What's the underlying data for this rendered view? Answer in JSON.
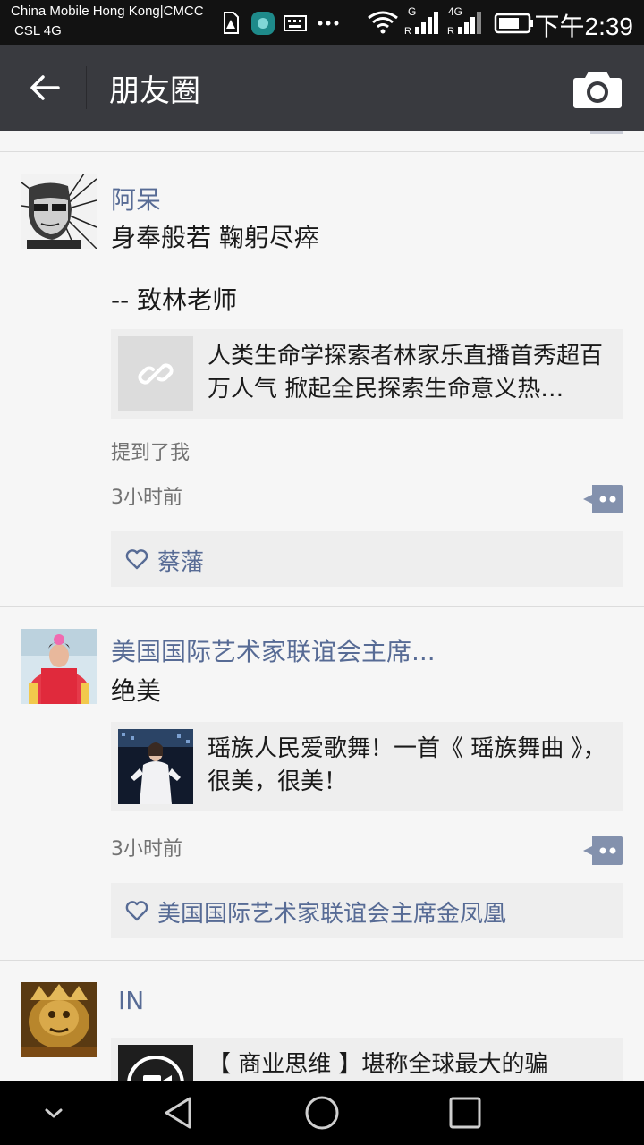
{
  "status_bar": {
    "carrier_line1": "China Mobile Hong Kong|CMCC",
    "carrier_line2": "CSL  4G",
    "network_1": "G",
    "network_2": "4G",
    "time": "下午2:39"
  },
  "header": {
    "title": "朋友圈",
    "back_icon": "arrow-left-icon",
    "camera_icon": "camera-icon"
  },
  "posts": [
    {
      "username": "阿呆",
      "content_lines": [
        "身奉般若 鞠躬尽瘁",
        "-- 致林老师"
      ],
      "link": {
        "thumb_icon": "link-icon",
        "title": "人类生命学探索者林家乐直播首秀超百万人气 掀起全民探索生命意义热…"
      },
      "mention": "提到了我",
      "time": "3小时前",
      "likes": "蔡藩"
    },
    {
      "username": "美国国际艺术家联谊会主席...",
      "content": "绝美",
      "link": {
        "title": "瑶族人民爱歌舞！一首《 瑶族舞曲 》，很美，很美！"
      },
      "time": "3小时前",
      "likes": "美国国际艺术家联谊会主席金凤凰"
    },
    {
      "username": "IN",
      "link": {
        "title": "【 商业思维 】堪称全球最大的骗"
      }
    }
  ],
  "colors": {
    "titlebar": "#393a3f",
    "username": "#576b95",
    "statusbar": "#121212"
  }
}
